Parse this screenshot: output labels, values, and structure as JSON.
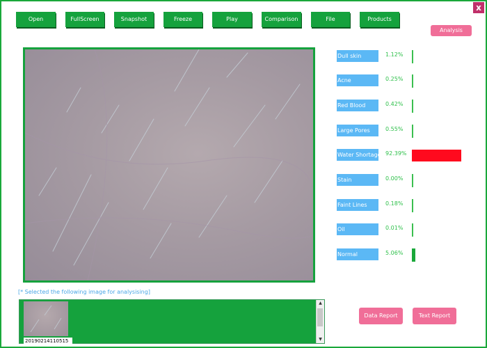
{
  "toolbar": {
    "buttons": [
      "Open",
      "FullScreen",
      "Snapshot",
      "Freeze",
      "Play",
      "Comparison",
      "File",
      "Products"
    ]
  },
  "close_label": "x",
  "analysis_label": "Analysis",
  "metrics": [
    {
      "label": "Dull skin",
      "value": "1.12%",
      "fraction": 0.0112,
      "color": "#3bbf4f"
    },
    {
      "label": "Acne",
      "value": "0.25%",
      "fraction": 0.0025,
      "color": "#3bbf4f"
    },
    {
      "label": "Red Blood",
      "value": "0.42%",
      "fraction": 0.0042,
      "color": "#3bbf4f"
    },
    {
      "label": "Large Pores",
      "value": "0.55%",
      "fraction": 0.0055,
      "color": "#3bbf4f"
    },
    {
      "label": "Water Shortage",
      "value": "92.39%",
      "fraction": 0.9239,
      "color": "#ff0a1e"
    },
    {
      "label": "Stain",
      "value": "0.00%",
      "fraction": 0.0,
      "color": "#3bbf4f"
    },
    {
      "label": "Faint Lines",
      "value": "0.18%",
      "fraction": 0.0018,
      "color": "#3bbf4f"
    },
    {
      "label": "Oil",
      "value": "0.01%",
      "fraction": 0.0001,
      "color": "#3bbf4f"
    },
    {
      "label": "Normal",
      "value": "5.06%",
      "fraction": 0.0506,
      "color": "#1aa83a"
    }
  ],
  "selection_label": "[* Selected the following image for analysising]",
  "thumbnail_caption": "20190214110515",
  "report_buttons": {
    "data_report": "Data Report",
    "text_report": "Text Report"
  },
  "colors": {
    "accent_green": "#15a23d",
    "metric_label_bg": "#5bb8f5",
    "pink_button": "#f06e98"
  }
}
